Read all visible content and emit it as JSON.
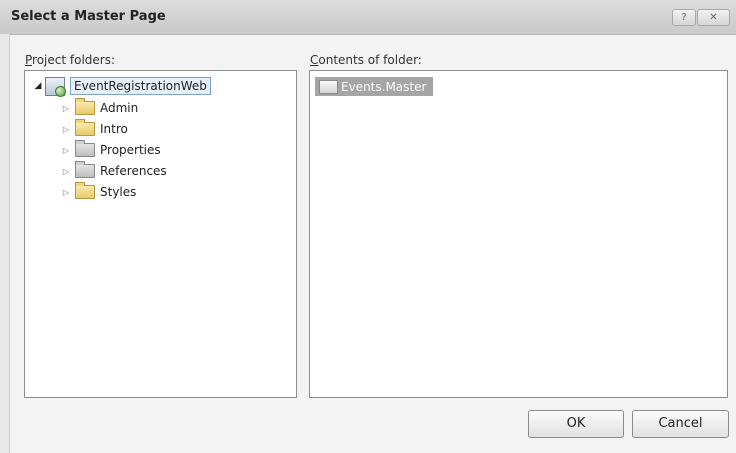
{
  "dialog": {
    "title": "Select a Master Page",
    "help_button": "?",
    "close_button": "✕",
    "project_folders_label_accel": "P",
    "project_folders_label_rest": "roject folders:",
    "contents_label_accel": "C",
    "contents_label_rest": "ontents of folder:",
    "ok_label": "OK",
    "cancel_label": "Cancel"
  },
  "tree": {
    "root": "EventRegistrationWeb",
    "folders": [
      "Admin",
      "Intro",
      "Properties",
      "References",
      "Styles"
    ]
  },
  "contents": {
    "selected_file": "Events.Master"
  }
}
